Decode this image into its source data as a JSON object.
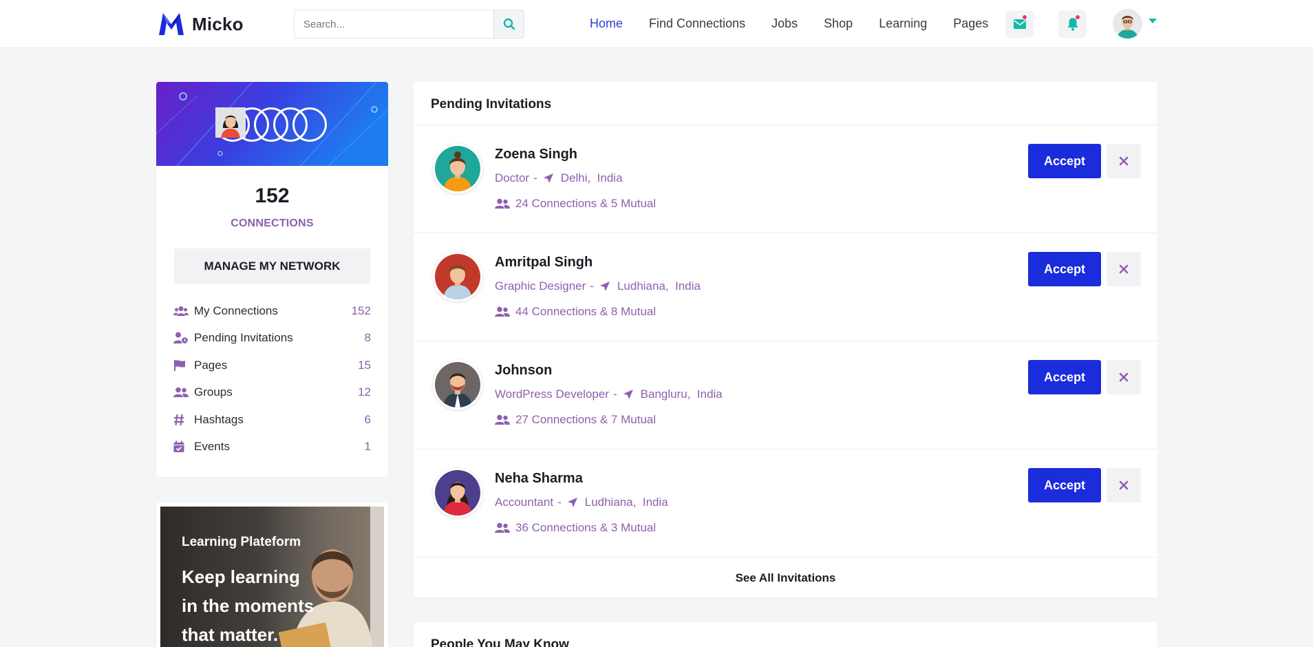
{
  "brand": {
    "name": "Micko"
  },
  "search": {
    "placeholder": "Search..."
  },
  "nav": {
    "items": [
      "Home",
      "Find Connections",
      "Jobs",
      "Shop",
      "Learning",
      "Pages"
    ],
    "active": "Home"
  },
  "colors": {
    "accent": "#1a2cdb",
    "purple": "#8e5fae",
    "teal": "#14b8a6",
    "notification_dot": "#f1306c"
  },
  "profile": {
    "connections_count": "152",
    "connections_label": "CONNECTIONS",
    "manage_label": "MANAGE MY NETWORK",
    "menu": [
      {
        "icon": "users-icon",
        "label": "My Connections",
        "count": "152"
      },
      {
        "icon": "user-clock-icon",
        "label": "Pending Invitations",
        "count": "8"
      },
      {
        "icon": "flag-icon",
        "label": "Pages",
        "count": "15"
      },
      {
        "icon": "group-icon",
        "label": "Groups",
        "count": "12"
      },
      {
        "icon": "hashtag-icon",
        "label": "Hashtags",
        "count": "6"
      },
      {
        "icon": "calendar-check-icon",
        "label": "Events",
        "count": "1"
      }
    ]
  },
  "promo": {
    "small": "Learning Plateform",
    "line1": "Keep learning",
    "line2": "in the moments",
    "line3": "that matter."
  },
  "invitations": {
    "title": "Pending Invitations",
    "accept_label": "Accept",
    "see_all_label": "See All Invitations",
    "items": [
      {
        "name": "Zoena Singh",
        "role": "Doctor",
        "city": "Delhi,",
        "country": "India",
        "mutual": "24 Connections & 5 Mutual",
        "avatar_bg": "#1fa79a"
      },
      {
        "name": "Amritpal Singh",
        "role": "Graphic Designer",
        "city": "Ludhiana,",
        "country": "India",
        "mutual": "44 Connections & 8 Mutual",
        "avatar_bg": "#c0392b"
      },
      {
        "name": "Johnson",
        "role": "WordPress Developer",
        "city": "Bangluru,",
        "country": "India",
        "mutual": "27 Connections & 7 Mutual",
        "avatar_bg": "#6e6664"
      },
      {
        "name": "Neha Sharma",
        "role": "Accountant",
        "city": "Ludhiana,",
        "country": "India",
        "mutual": "36 Connections & 3 Mutual",
        "avatar_bg": "#4e3f8c"
      }
    ]
  },
  "people": {
    "title": "People You May Know"
  }
}
